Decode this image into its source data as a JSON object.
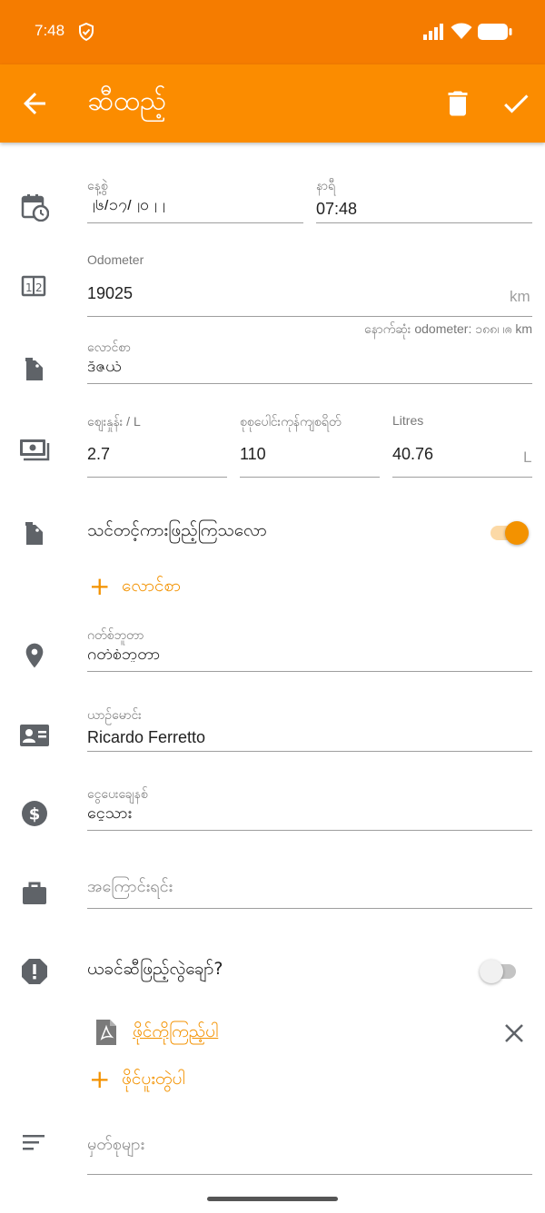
{
  "colors": {
    "status_bar": "#f57c00",
    "app_bar": "#fb8c00",
    "accent": "#f39200",
    "icon_gray": "#5f6368",
    "divider": "#9e9e9e"
  },
  "status": {
    "time": "7:48",
    "icons": [
      "vpn-shield-icon",
      "signal-icon",
      "wifi-icon",
      "battery-icon"
    ]
  },
  "header": {
    "title": "ဆီထည့်",
    "back_icon": "arrow-back-icon",
    "delete_icon": "trash-icon",
    "save_icon": "check-icon"
  },
  "date_time": {
    "date_label": "နေ့စွဲ",
    "date_value": "၂၆/၁၇/၂၀၂၂",
    "time_label": "နာရီ",
    "time_value": "07:48"
  },
  "odometer": {
    "label": "Odometer",
    "value": "19025",
    "unit": "km",
    "helper": "နောက်ဆုံး odometer: ၁၈၈၊ ၊ၐ km"
  },
  "fuel_type": {
    "label": "လောင်စာ",
    "value": "ဒီဇယ်"
  },
  "fuel_cost": {
    "price_label": "စျေးနှုန်း / L",
    "price_value": "2.7",
    "total_label": "စုစုပေါင်းကုန်ကျစရိတ်",
    "total_value": "110",
    "litres_label": "Litres",
    "litres_value": "40.76",
    "litres_unit": "L"
  },
  "full_tank": {
    "label": "သင်တင့်ကားဖြည့်ကြသလော",
    "enabled": true
  },
  "add_fuel": {
    "label": "လောင်စာ"
  },
  "station": {
    "label": "ဂတ်စ်ဘူတာ",
    "value": "ဂတ်စ်ဘူတာ"
  },
  "driver": {
    "label": "ယာဉ်မောင်း",
    "value": "Ricardo Ferretto"
  },
  "payment": {
    "label": "ငွေပေးချေနစ်",
    "value": "ငွေသား"
  },
  "reason": {
    "placeholder": "အကြောင်းရင်း"
  },
  "missed": {
    "label": "ယခင်ဆီဖြည့်လွဲချော်?",
    "enabled": false
  },
  "attachment": {
    "file_label": "ဖိုင်ကိုကြည့်ပါ",
    "add_label": "ဖိုင်ပူးတွဲပါ"
  },
  "notes": {
    "placeholder": "မှတ်စုများ"
  }
}
